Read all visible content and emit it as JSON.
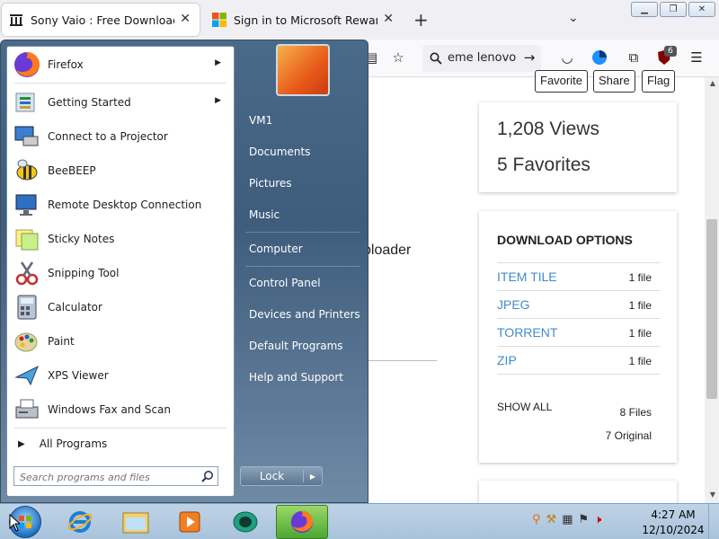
{
  "browser": {
    "tabs": [
      {
        "title": "Sony Vaio : Free Download, Bor"
      },
      {
        "title": "Sign in to Microsoft Rewards"
      }
    ],
    "url_text": "eme lenovo",
    "extension_badge": "6"
  },
  "page": {
    "action_buttons": [
      "Favorite",
      "Share",
      "Flag"
    ],
    "views": "1,208 Views",
    "favorites": "5 Favorites",
    "download": {
      "heading": "DOWNLOAD OPTIONS",
      "rows": [
        {
          "label": "ITEM TILE",
          "count": "1 file"
        },
        {
          "label": "JPEG",
          "count": "1 file"
        },
        {
          "label": "TORRENT",
          "count": "1 file"
        },
        {
          "label": "ZIP",
          "count": "1 file"
        }
      ],
      "show_all": "SHOW ALL",
      "files": "8 Files",
      "original": "7 Original"
    },
    "partial_link": "e",
    "partial_text": "bloader"
  },
  "start_menu": {
    "programs": [
      {
        "label": "Firefox",
        "has_arrow": true
      },
      {
        "label": "Getting Started",
        "has_arrow": true
      },
      {
        "label": "Connect to a Projector"
      },
      {
        "label": "BeeBEEP"
      },
      {
        "label": "Remote Desktop Connection"
      },
      {
        "label": "Sticky Notes"
      },
      {
        "label": "Snipping Tool"
      },
      {
        "label": "Calculator"
      },
      {
        "label": "Paint"
      },
      {
        "label": "XPS Viewer"
      },
      {
        "label": "Windows Fax and Scan"
      }
    ],
    "all_programs": "All Programs",
    "search_placeholder": "Search programs and files",
    "right_items": [
      "VM1",
      "Documents",
      "Pictures",
      "Music",
      "Computer",
      "Control Panel",
      "Devices and Printers",
      "Default Programs",
      "Help and Support"
    ],
    "lock_label": "Lock"
  },
  "taskbar": {
    "time": "4:27 AM",
    "date": "12/10/2024"
  },
  "colors": {
    "link_blue": "#428bca",
    "start_menu_blue": "#4a6a8a",
    "taskbar_blue": "#bfd3e6"
  }
}
